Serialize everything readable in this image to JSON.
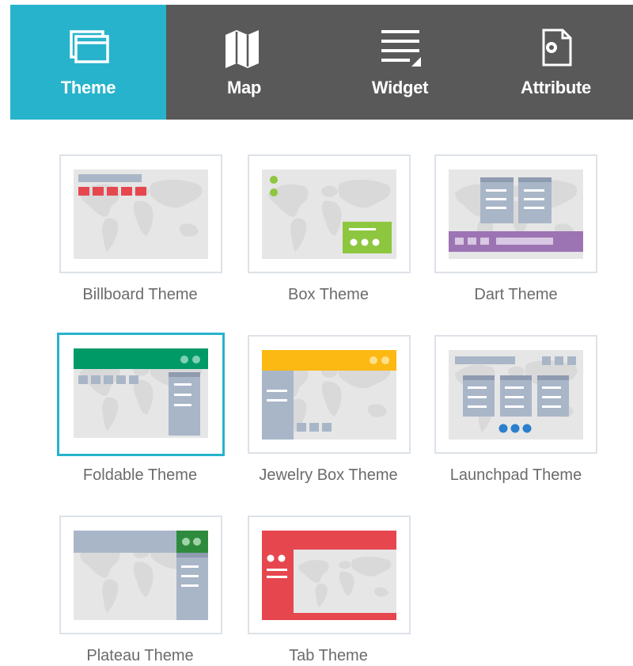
{
  "tabs": [
    {
      "id": "theme",
      "label": "Theme",
      "icon": "theme-icon",
      "active": true
    },
    {
      "id": "map",
      "label": "Map",
      "icon": "map-icon",
      "active": false
    },
    {
      "id": "widget",
      "label": "Widget",
      "icon": "widget-icon",
      "active": false
    },
    {
      "id": "attribute",
      "label": "Attribute",
      "icon": "attribute-icon",
      "active": false
    }
  ],
  "themes": [
    {
      "id": "billboard",
      "label": "Billboard Theme",
      "selected": false
    },
    {
      "id": "box",
      "label": "Box Theme",
      "selected": false
    },
    {
      "id": "dart",
      "label": "Dart Theme",
      "selected": false
    },
    {
      "id": "foldable",
      "label": "Foldable Theme",
      "selected": true
    },
    {
      "id": "jewelry-box",
      "label": "Jewelry Box Theme",
      "selected": false
    },
    {
      "id": "launchpad",
      "label": "Launchpad Theme",
      "selected": false
    },
    {
      "id": "plateau",
      "label": "Plateau Theme",
      "selected": false
    },
    {
      "id": "tab",
      "label": "Tab Theme",
      "selected": false
    }
  ],
  "colors": {
    "accent": "#27b3cc",
    "toolbar": "#595959",
    "red": "#e6474f",
    "green": "#8dc63f",
    "purple": "#9d74b3",
    "teal": "#009a67",
    "yellow": "#fdb913",
    "blue": "#2c7fcb",
    "dark_green": "#2e8b3d",
    "slate": "#a9b6c8"
  }
}
